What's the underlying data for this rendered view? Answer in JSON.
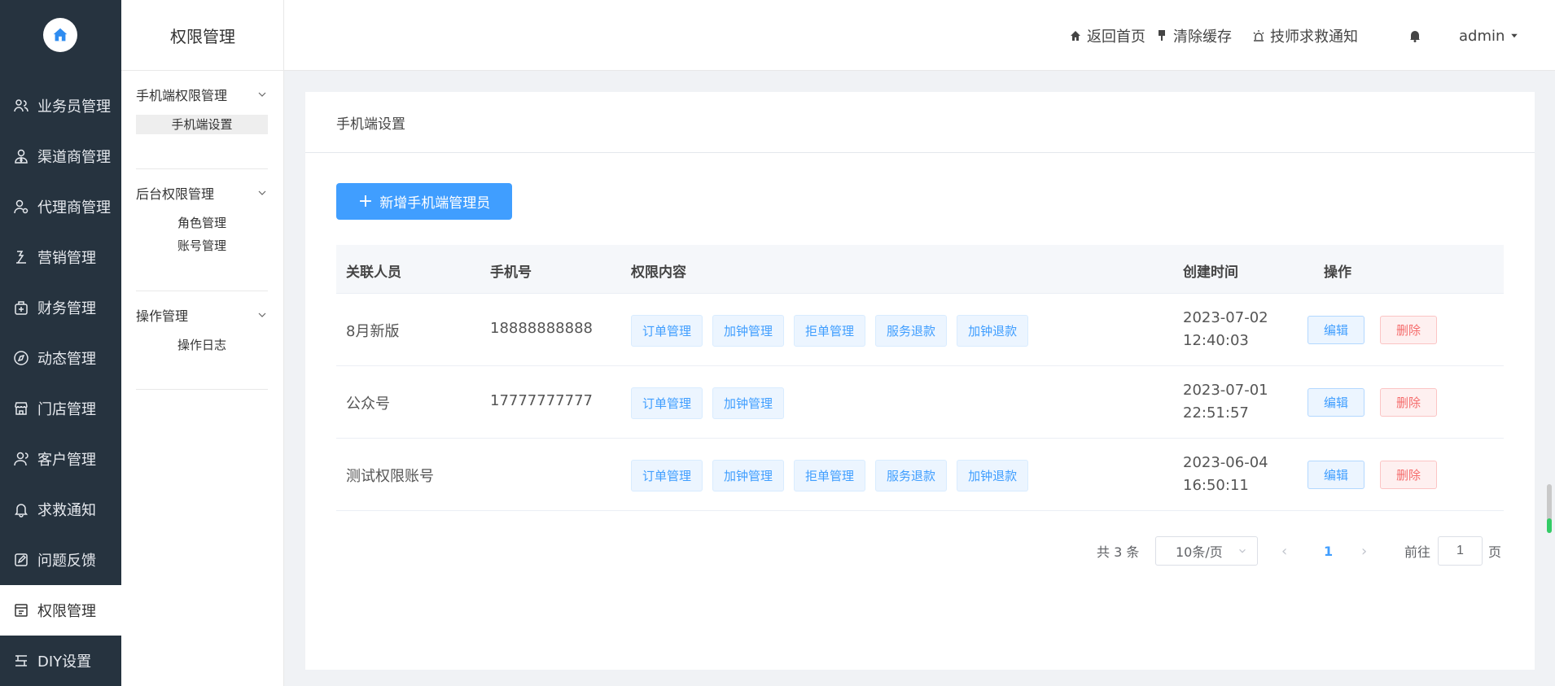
{
  "sidebar": {
    "items": [
      {
        "label": "业务员管理",
        "icon": "users-icon"
      },
      {
        "label": "渠道商管理",
        "icon": "user-tie-icon"
      },
      {
        "label": "代理商管理",
        "icon": "agent-icon"
      },
      {
        "label": "营销管理",
        "icon": "marketing-icon"
      },
      {
        "label": "财务管理",
        "icon": "finance-icon"
      },
      {
        "label": "动态管理",
        "icon": "compass-icon"
      },
      {
        "label": "门店管理",
        "icon": "store-icon"
      },
      {
        "label": "客户管理",
        "icon": "customer-icon"
      },
      {
        "label": "求救通知",
        "icon": "bell-icon"
      },
      {
        "label": "问题反馈",
        "icon": "feedback-icon"
      },
      {
        "label": "权限管理",
        "icon": "permission-icon"
      },
      {
        "label": "DIY设置",
        "icon": "diy-icon"
      }
    ],
    "active_index": 10
  },
  "subnav": {
    "title": "权限管理",
    "groups": [
      {
        "label": "手机端权限管理",
        "links": [
          "手机端设置"
        ]
      },
      {
        "label": "后台权限管理",
        "links": [
          "角色管理",
          "账号管理"
        ]
      },
      {
        "label": "操作管理",
        "links": [
          "操作日志"
        ]
      }
    ]
  },
  "header": {
    "home": "返回首页",
    "clear_cache": "清除缓存",
    "sos_notice": "技师求救通知",
    "user": "admin"
  },
  "card": {
    "title": "手机端设置",
    "add_button": "新增手机端管理员"
  },
  "table": {
    "columns": [
      "关联人员",
      "手机号",
      "权限内容",
      "创建时间",
      "操作"
    ],
    "rows": [
      {
        "name": "8月新版",
        "phone": "18888888888",
        "tags": [
          "订单管理",
          "加钟管理",
          "拒单管理",
          "服务退款",
          "加钟退款"
        ],
        "date": "2023-07-02",
        "time": "12:40:03"
      },
      {
        "name": "公众号",
        "phone": "17777777777",
        "tags": [
          "订单管理",
          "加钟管理"
        ],
        "date": "2023-07-01",
        "time": "22:51:57"
      },
      {
        "name": "测试权限账号",
        "phone": "",
        "tags": [
          "订单管理",
          "加钟管理",
          "拒单管理",
          "服务退款",
          "加钟退款"
        ],
        "date": "2023-06-04",
        "time": "16:50:11"
      }
    ],
    "edit_label": "编辑",
    "delete_label": "删除"
  },
  "pagination": {
    "total": "共 3 条",
    "page_size": "10条/页",
    "current": "1",
    "goto_prefix": "前往",
    "goto_value": "1",
    "goto_suffix": "页"
  },
  "colors": {
    "sidebar_bg": "#26333f",
    "primary": "#409eff",
    "danger": "#f56c6c"
  }
}
